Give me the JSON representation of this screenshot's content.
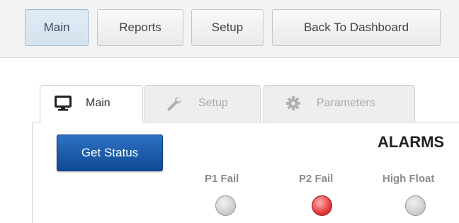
{
  "nav": {
    "buttons": [
      {
        "label": "Main",
        "active": true
      },
      {
        "label": "Reports",
        "active": false
      },
      {
        "label": "Setup",
        "active": false
      },
      {
        "label": "Back To Dashboard",
        "active": false
      }
    ]
  },
  "tabs": [
    {
      "label": "Main",
      "icon": "monitor-icon",
      "active": true
    },
    {
      "label": "Setup",
      "icon": "wrench-icon",
      "active": false
    },
    {
      "label": "Parameters",
      "icon": "gear-icon",
      "active": false
    }
  ],
  "main": {
    "get_status_label": "Get Status",
    "alarms_title": "ALARMS",
    "alarms": [
      {
        "label": "P1 Fail",
        "state": "off",
        "color": "#c9c9c9"
      },
      {
        "label": "P2 Fail",
        "state": "on",
        "color": "#e33b3b"
      },
      {
        "label": "High Float",
        "state": "off",
        "color": "#c9c9c9"
      }
    ]
  },
  "colors": {
    "accent_blue": "#1f5fae",
    "active_nav": "#d3e1ee",
    "alarm_red": "#e33b3b"
  }
}
